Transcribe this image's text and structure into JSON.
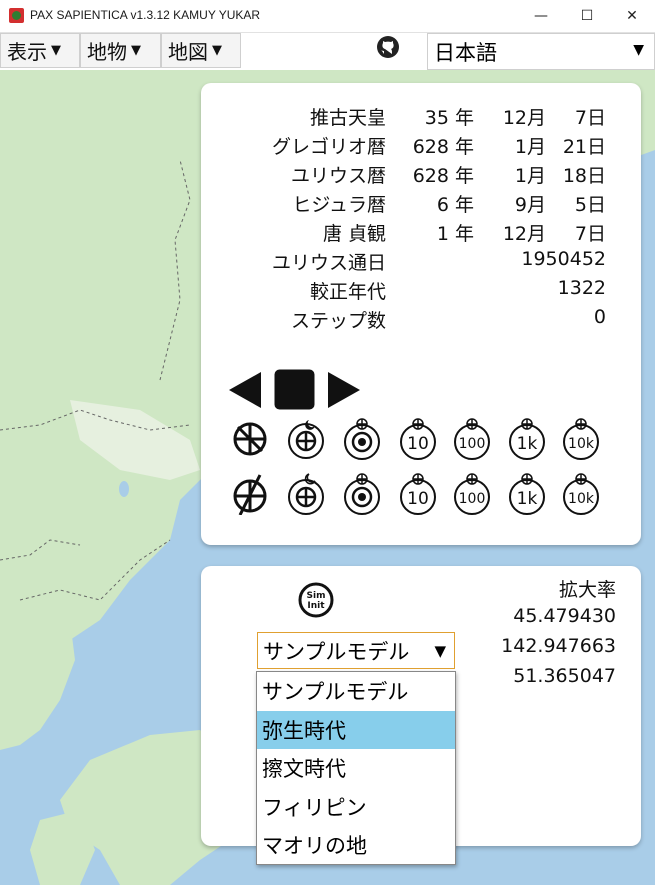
{
  "window": {
    "title": "PAX SAPIENTICA v1.3.12 KAMUY YUKAR",
    "min_glyph": "—",
    "max_glyph": "☐",
    "close_glyph": "✕"
  },
  "menubar": {
    "menus": [
      {
        "label": "表示",
        "arrow": "▼"
      },
      {
        "label": "地物",
        "arrow": "▼"
      },
      {
        "label": "地図",
        "arrow": "▼"
      }
    ],
    "github_icon": "github-icon",
    "language": {
      "value": "日本語",
      "arrow": "▼"
    }
  },
  "calendar": {
    "rows": [
      {
        "label": "推古天皇",
        "year": "35 年",
        "month": "12月",
        "day": "7日"
      },
      {
        "label": "グレゴリオ暦",
        "year": "628 年",
        "month": "1月",
        "day": "21日"
      },
      {
        "label": "ユリウス暦",
        "year": "628 年",
        "month": "1月",
        "day": "18日"
      },
      {
        "label": "ヒジュラ暦",
        "year": "6 年",
        "month": "9月",
        "day": "5日"
      },
      {
        "label": "唐 貞観",
        "year": "1 年",
        "month": "12月",
        "day": "7日"
      }
    ],
    "julian_day_label": "ユリウス通日",
    "julian_day_value": "1950452",
    "calibrated_label": "較正年代",
    "calibrated_value": "1322",
    "steps_label": "ステップ数",
    "steps_value": "0"
  },
  "controls": {
    "playback": [
      "reverse-play-icon",
      "stop-icon",
      "play-icon"
    ],
    "row1_texts": [
      "10",
      "100",
      "1k",
      "10k"
    ],
    "row2_texts": [
      "10",
      "100",
      "1k",
      "10k"
    ]
  },
  "simulation": {
    "init_icon_text": [
      "Sim",
      "Init"
    ],
    "zoom_label": "拡大率",
    "zoom_value": "45.479430",
    "longitude": "142.947663",
    "latitude": "51.365047",
    "model_select": {
      "value": "サンプルモデル",
      "arrow": "▼"
    },
    "model_options": [
      "サンプルモデル",
      "弥生時代",
      "擦文時代",
      "フィリピン",
      "マオリの地"
    ],
    "highlighted_option": "弥生時代"
  },
  "colors": {
    "sea": "#a9cde8",
    "land": "#cfe7c4",
    "highlight": "#87ceeb",
    "select_border": "#e0a030"
  }
}
